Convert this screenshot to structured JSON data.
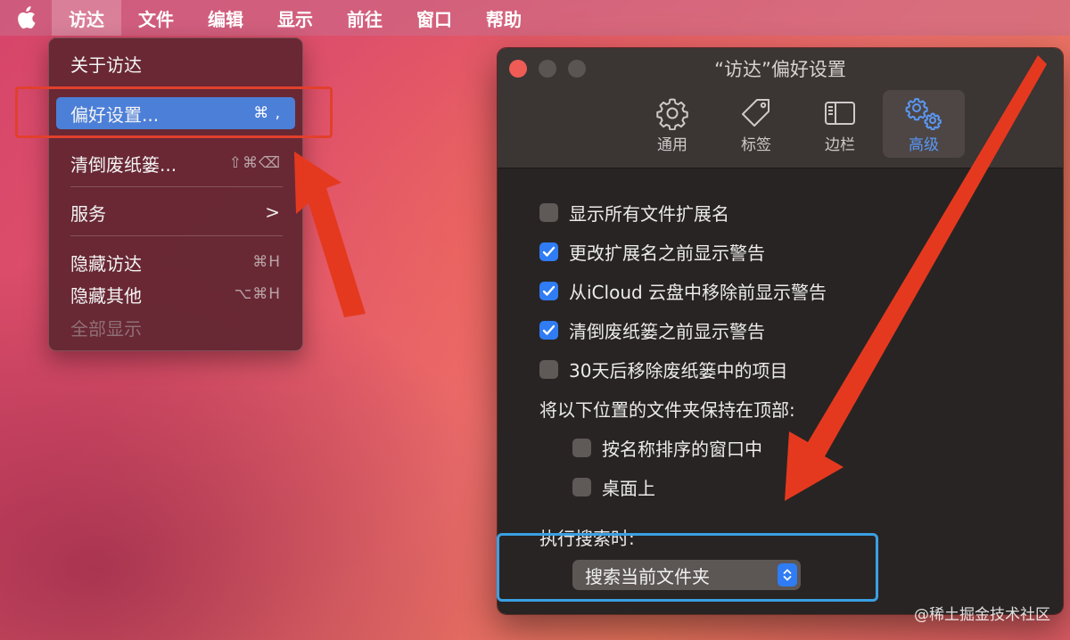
{
  "menubar": {
    "apple_icon": "apple-logo-icon",
    "items": [
      {
        "label": "访达",
        "active": true
      },
      {
        "label": "文件"
      },
      {
        "label": "编辑"
      },
      {
        "label": "显示"
      },
      {
        "label": "前往"
      },
      {
        "label": "窗口"
      },
      {
        "label": "帮助"
      }
    ]
  },
  "finder_menu": {
    "about": {
      "label": "关于访达"
    },
    "preferences": {
      "label": "偏好设置...",
      "shortcut": "⌘ ,"
    },
    "empty_trash": {
      "label": "清倒废纸篓...",
      "shortcut": "⇧⌘⌫"
    },
    "services": {
      "label": "服务",
      "submenu": ">"
    },
    "hide_finder": {
      "label": "隐藏访达",
      "shortcut": "⌘H"
    },
    "hide_others": {
      "label": "隐藏其他",
      "shortcut": "⌥⌘H"
    },
    "show_all": {
      "label": "全部显示",
      "disabled": true
    }
  },
  "prefs_window": {
    "title": "“访达”偏好设置",
    "tabs": [
      {
        "label": "通用",
        "icon": "gear-icon"
      },
      {
        "label": "标签",
        "icon": "tag-icon"
      },
      {
        "label": "边栏",
        "icon": "sidebar-icon"
      },
      {
        "label": "高级",
        "icon": "gears-icon",
        "selected": true
      }
    ],
    "options": [
      {
        "label": "显示所有文件扩展名",
        "checked": false
      },
      {
        "label": "更改扩展名之前显示警告",
        "checked": true
      },
      {
        "label": "从iCloud 云盘中移除前显示警告",
        "checked": true
      },
      {
        "label": "清倒废纸篓之前显示警告",
        "checked": true
      },
      {
        "label": "30天后移除废纸篓中的项目",
        "checked": false
      }
    ],
    "keep_folders_label": "将以下位置的文件夹保持在顶部:",
    "keep_folders": [
      {
        "label": "按名称排序的窗口中",
        "checked": false
      },
      {
        "label": "桌面上",
        "checked": false
      }
    ],
    "search_label": "执行搜索时:",
    "search_select_value": "搜索当前文件夹"
  },
  "colors": {
    "highlight": "#4c7fd8",
    "checkbox_on": "#2f7cf4",
    "annotation_red": "#e2402c",
    "annotation_blue": "#3aa0e3"
  },
  "watermark": "@稀土掘金技术社区"
}
